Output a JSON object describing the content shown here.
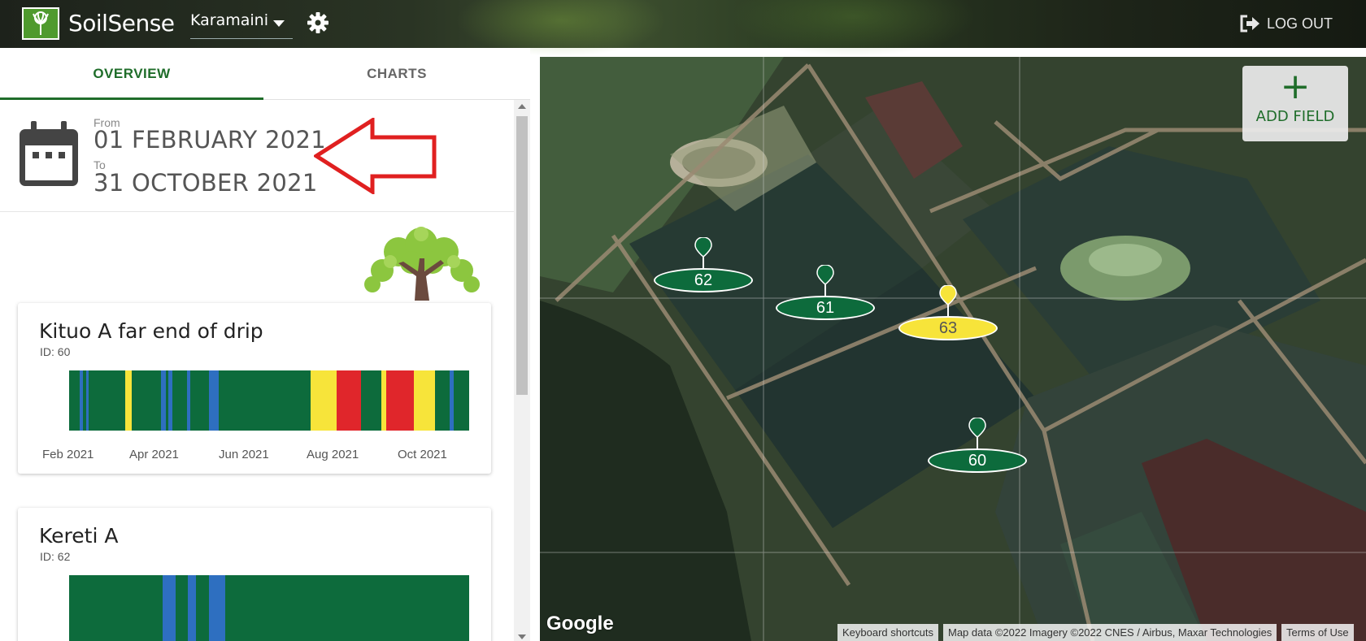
{
  "app": {
    "name": "SoilSense",
    "farm": "Karamaini",
    "logout_label": "LOG OUT"
  },
  "tabs": [
    {
      "label": "OVERVIEW"
    },
    {
      "label": "CHARTS"
    }
  ],
  "daterange": {
    "from_label": "From",
    "from_value": "01 FEBRUARY 2021",
    "to_label": "To",
    "to_value": "31 OCTOBER 2021"
  },
  "fields": [
    {
      "title": "Kituo A far end of drip",
      "id_text": "ID: 60",
      "axis_ticks": [
        "Feb 2021",
        "Apr 2021",
        "Jun 2021",
        "Aug 2021",
        "Oct 2021"
      ]
    },
    {
      "title": "Kereti A",
      "id_text": "ID: 62"
    }
  ],
  "status_colors": {
    "ok": "#0d6b3c",
    "wet": "#2e6fc0",
    "warning": "#f7e43a",
    "critical": "#e0262b"
  },
  "map": {
    "add_field_label": "ADD FIELD",
    "markers": [
      {
        "label": "62",
        "status": "ok"
      },
      {
        "label": "61",
        "status": "ok"
      },
      {
        "label": "63",
        "status": "warning"
      },
      {
        "label": "60",
        "status": "ok"
      }
    ],
    "google_logo": "Google",
    "keyboard_shortcuts": "Keyboard shortcuts",
    "map_data": "Map data ©2022 Imagery ©2022 CNES / Airbus, Maxar Technologies",
    "terms": "Terms of Use"
  }
}
